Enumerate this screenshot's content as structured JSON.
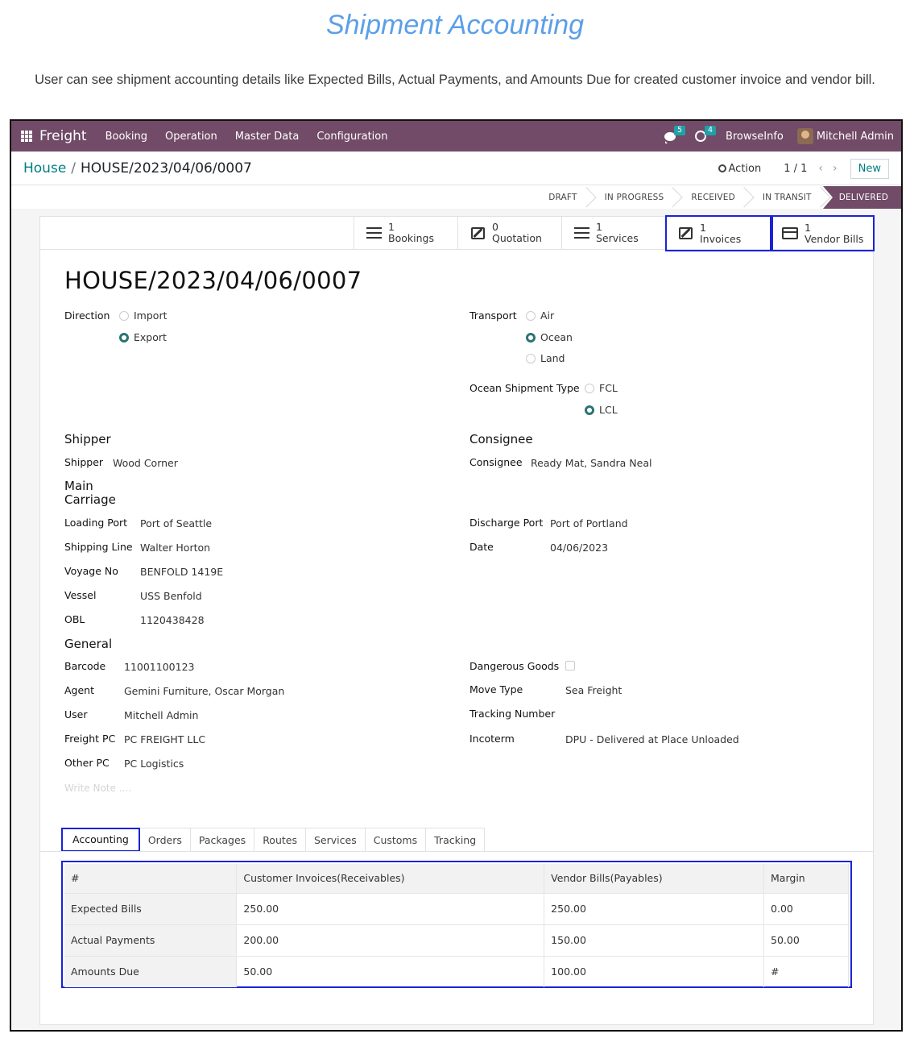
{
  "doc": {
    "title": "Shipment Accounting",
    "subtitle": "User can see shipment accounting details like Expected Bills, Actual Payments, and Amounts Due for created customer invoice and vendor bill."
  },
  "navbar": {
    "app": "Freight",
    "menu": [
      "Booking",
      "Operation",
      "Master Data",
      "Configuration"
    ],
    "messages_count": "5",
    "activities_count": "4",
    "company": "BrowseInfo",
    "user": "Mitchell Admin"
  },
  "control_panel": {
    "breadcrumb_parent": "House",
    "breadcrumb_sep": "/",
    "breadcrumb_current": "HOUSE/2023/04/06/0007",
    "action_label": "Action",
    "pager": "1 / 1",
    "new_label": "New"
  },
  "stages": [
    "DRAFT",
    "IN PROGRESS",
    "RECEIVED",
    "IN TRANSIT",
    "DELIVERED"
  ],
  "active_stage": "DELIVERED",
  "smart_buttons": [
    {
      "count": "1",
      "label": "Bookings"
    },
    {
      "count": "0",
      "label": "Quotation"
    },
    {
      "count": "1",
      "label": "Services"
    },
    {
      "count": "1",
      "label": "Invoices"
    },
    {
      "count": "1",
      "label": "Vendor Bills"
    }
  ],
  "record": {
    "title": "HOUSE/2023/04/06/0007",
    "direction": {
      "label": "Direction",
      "options": [
        "Import",
        "Export"
      ],
      "selected": "Export"
    },
    "transport": {
      "label": "Transport",
      "options": [
        "Air",
        "Ocean",
        "Land"
      ],
      "selected": "Ocean"
    },
    "ocean_type": {
      "label": "Ocean Shipment Type",
      "options": [
        "FCL",
        "LCL"
      ],
      "selected": "LCL"
    },
    "shipper_section": "Shipper",
    "shipper": {
      "label": "Shipper",
      "value": "Wood Corner"
    },
    "consignee_section": "Consignee",
    "consignee": {
      "label": "Consignee",
      "value": "Ready Mat, Sandra Neal"
    },
    "main_carriage_section": [
      "Main",
      "Carriage"
    ],
    "loading_port": {
      "label": "Loading Port",
      "value": "Port of Seattle"
    },
    "shipping_line": {
      "label": "Shipping Line",
      "value": "Walter Horton"
    },
    "voyage_no": {
      "label": "Voyage No",
      "value": "BENFOLD 1419E"
    },
    "vessel": {
      "label": "Vessel",
      "value": "USS Benfold"
    },
    "obl": {
      "label": "OBL",
      "value": "1120438428"
    },
    "discharge_port": {
      "label": "Discharge Port",
      "value": "Port of Portland"
    },
    "date": {
      "label": "Date",
      "value": "04/06/2023"
    },
    "general_section": "General",
    "barcode": {
      "label": "Barcode",
      "value": "11001100123"
    },
    "agent": {
      "label": "Agent",
      "value": "Gemini Furniture, Oscar Morgan"
    },
    "user": {
      "label": "User",
      "value": "Mitchell Admin"
    },
    "freight_pc": {
      "label": "Freight PC",
      "value": "PC FREIGHT LLC"
    },
    "other_pc": {
      "label": "Other PC",
      "value": "PC Logistics"
    },
    "dangerous_goods": {
      "label": "Dangerous Goods",
      "checked": false
    },
    "move_type": {
      "label": "Move Type",
      "value": "Sea Freight"
    },
    "tracking_number": {
      "label": "Tracking Number",
      "value": ""
    },
    "incoterm": {
      "label": "Incoterm",
      "value": "DPU - Delivered at Place Unloaded"
    },
    "note_placeholder": "Write Note ...."
  },
  "tabs": [
    "Accounting",
    "Orders",
    "Packages",
    "Routes",
    "Services",
    "Customs",
    "Tracking"
  ],
  "active_tab": "Accounting",
  "accounting": {
    "headers": [
      "#",
      "Customer Invoices(Receivables)",
      "Vendor Bills(Payables)",
      "Margin"
    ],
    "rows": [
      [
        "Expected Bills",
        "250.00",
        "250.00",
        "0.00"
      ],
      [
        "Actual Payments",
        "200.00",
        "150.00",
        "50.00"
      ],
      [
        "Amounts Due",
        "50.00",
        "100.00",
        "#"
      ]
    ]
  }
}
